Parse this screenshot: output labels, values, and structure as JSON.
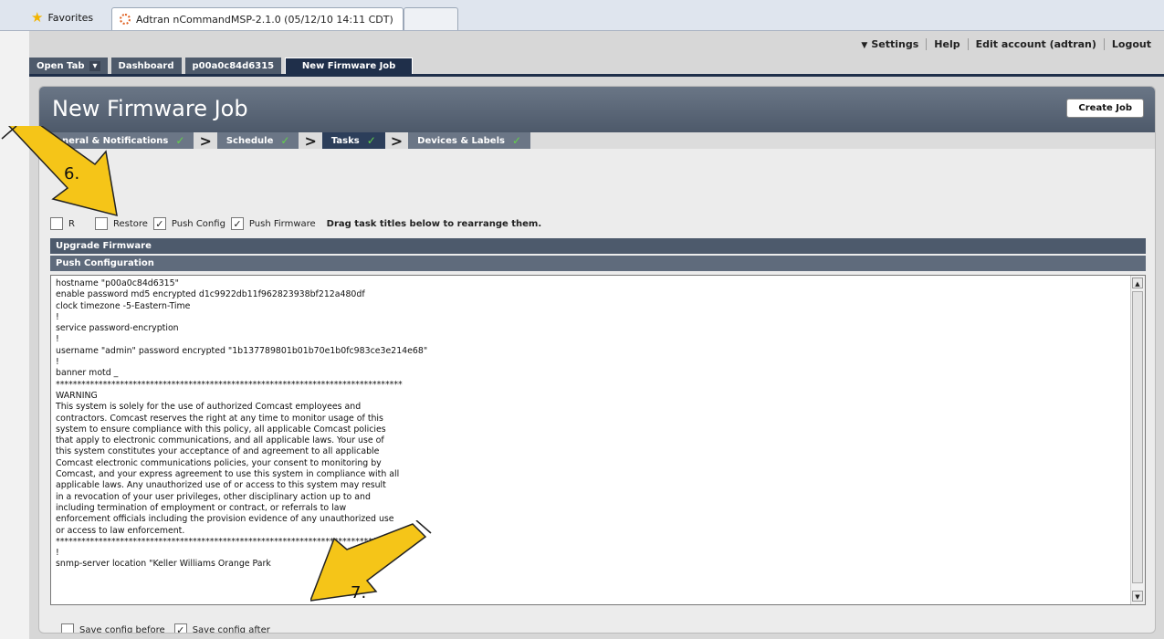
{
  "browser": {
    "favorites_label": "Favorites",
    "tab_title": "Adtran nCommandMSP-2.1.0 (05/12/10 14:11 CDT)"
  },
  "topnav": {
    "settings": "Settings",
    "help": "Help",
    "edit_account": "Edit account (adtran)",
    "logout": "Logout"
  },
  "app_tabs": {
    "open_tab": "Open Tab",
    "dashboard": "Dashboard",
    "device": "p00a0c84d6315",
    "active": "New Firmware Job"
  },
  "page": {
    "title": "New Firmware Job",
    "create_button": "Create Job"
  },
  "wizard": {
    "steps": [
      "General & Notifications",
      "Schedule",
      "Tasks",
      "Devices & Labels"
    ]
  },
  "tasks": {
    "options": [
      {
        "label": "R",
        "checked": false
      },
      {
        "label": "Restore",
        "checked": false
      },
      {
        "label": "Push Config",
        "checked": true
      },
      {
        "label": "Push Firmware",
        "checked": true
      }
    ],
    "hint": "Drag task titles below to rearrange them."
  },
  "sections": {
    "upgrade": "Upgrade Firmware",
    "push": "Push Configuration"
  },
  "config_text": "hostname \"p00a0c84d6315\"\nenable password md5 encrypted d1c9922db11f962823938bf212a480df\nclock timezone -5-Eastern-Time\n!\nservice password-encryption\n!\nusername \"admin\" password encrypted \"1b137789801b01b70e1b0fc983ce3e214e68\"\n!\nbanner motd _\n*********************************************************************************\nWARNING\nThis system is solely for the use of authorized Comcast employees and\ncontractors. Comcast reserves the right at any time to monitor usage of this\nsystem to ensure compliance with this policy, all applicable Comcast policies\nthat apply to electronic communications, and all applicable laws. Your use of\nthis system constitutes your acceptance of and agreement to all applicable\nComcast electronic communications policies, your consent to monitoring by\nComcast, and your express agreement to use this system in compliance with all\napplicable laws. Any unauthorized use of or access to this system may result\nin a revocation of your user privileges, other disciplinary action up to and\nincluding termination of employment or contract, or referrals to law\nenforcement officials including the provision evidence of any unauthorized use\nor access to law enforcement.\n*********************************************************************************\n!\nsnmp-server location \"Keller Williams Orange Park",
  "save": {
    "before_label": "Save config before",
    "before_checked": false,
    "after_label": "Save config after",
    "after_checked": true
  },
  "annotations": {
    "arrow1": "6.",
    "arrow2": "7."
  },
  "colors": {
    "arrow": "#f5c518",
    "header": "#4d596a",
    "check": "#62d14a"
  }
}
